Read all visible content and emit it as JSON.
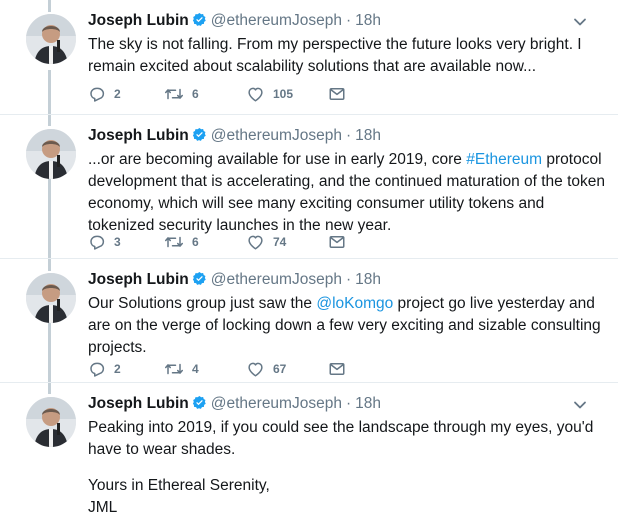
{
  "author": {
    "name": "Joseph Lubin",
    "handle": "@ethereumJoseph",
    "separator": "·"
  },
  "tweets": [
    {
      "time": "18h",
      "parts": [
        {
          "text": "The sky is not falling. From my perspective the future looks very bright. I remain excited about scalability solutions that are available now..."
        }
      ],
      "replies": "2",
      "retweets": "6",
      "likes": "105"
    },
    {
      "time": "18h",
      "parts": [
        {
          "text": "...or are becoming available for use in early 2019, core "
        },
        {
          "text": "#Ethereum",
          "link": true
        },
        {
          "text": " protocol development that is accelerating, and the continued maturation of the token economy, which will see many exciting consumer utility tokens and tokenized security launches in the new year."
        }
      ],
      "replies": "3",
      "retweets": "6",
      "likes": "74"
    },
    {
      "time": "18h",
      "parts": [
        {
          "text": "Our Solutions group just saw the "
        },
        {
          "text": "@loKomgo",
          "link": true
        },
        {
          "text": " project go live yesterday and are on the verge of locking down a few very exciting and sizable consulting projects."
        }
      ],
      "replies": "2",
      "retweets": "4",
      "likes": "67"
    },
    {
      "time": "18h",
      "paragraphs": [
        "Peaking into 2019, if you could see the landscape through my eyes, you'd have to wear shades.",
        "Yours in Ethereal Serenity,",
        "JML"
      ]
    }
  ],
  "colors": {
    "link": "#1b95e0",
    "muted": "#657786",
    "thread_line": "#c4cfd6",
    "verified": "#1da1f2"
  },
  "icons": [
    "verified-badge-icon",
    "chevron-down-icon",
    "reply-icon",
    "retweet-icon",
    "like-icon",
    "direct-message-icon"
  ]
}
